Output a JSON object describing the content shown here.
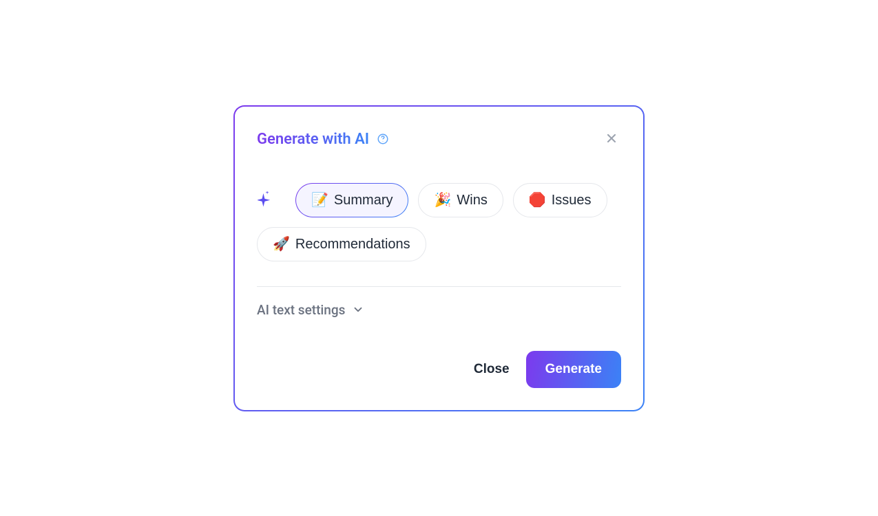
{
  "modal": {
    "title": "Generate with AI",
    "chips": [
      {
        "emoji": "📝",
        "label": "Summary",
        "active": true
      },
      {
        "emoji": "🎉",
        "label": "Wins",
        "active": false
      },
      {
        "emoji": "🛑",
        "label": "Issues",
        "active": false
      },
      {
        "emoji": "🚀",
        "label": "Recommendations",
        "active": false
      }
    ],
    "settings_label": "AI text settings",
    "footer": {
      "close_label": "Close",
      "generate_label": "Generate"
    }
  }
}
